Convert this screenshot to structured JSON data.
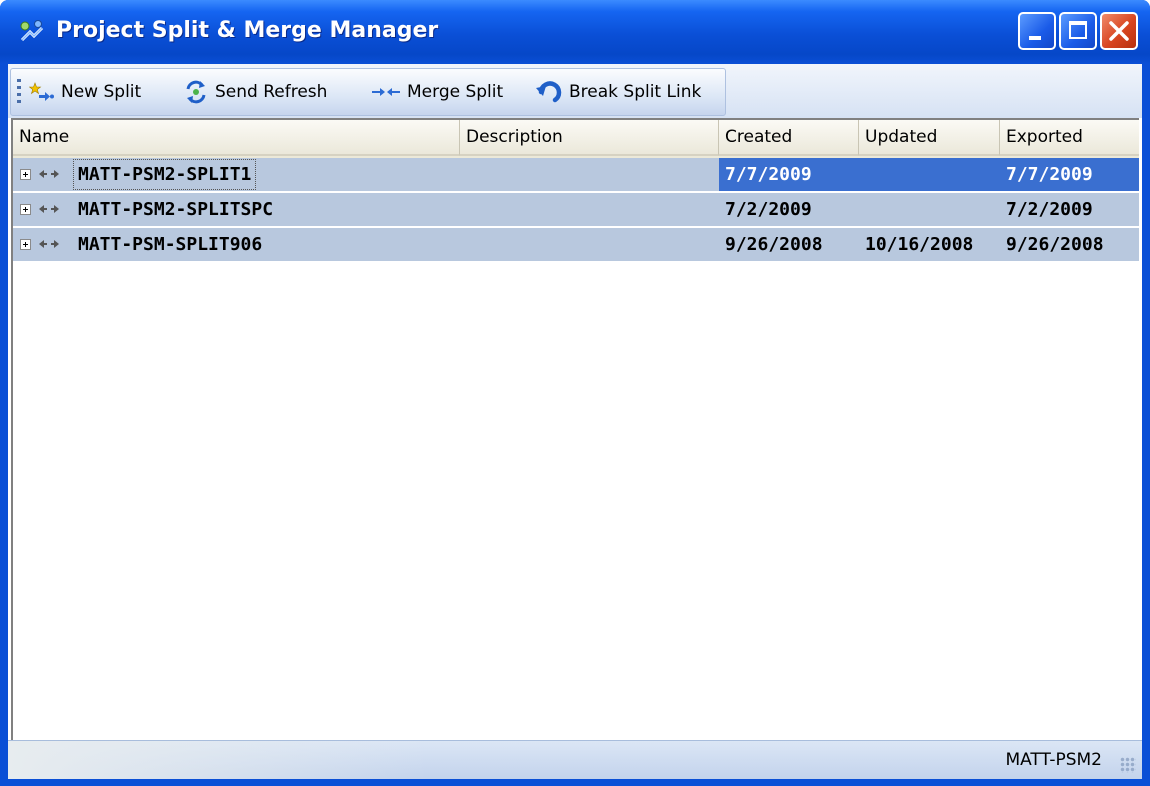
{
  "window": {
    "title": "Project Split & Merge Manager",
    "icon": "split-merge-app-icon",
    "controls": [
      {
        "name": "minimize-button",
        "icon": "minimize-icon"
      },
      {
        "name": "maximize-button",
        "icon": "maximize-icon"
      },
      {
        "name": "close-button",
        "icon": "close-icon"
      }
    ]
  },
  "toolbar": {
    "new_split": "New Split",
    "send_refresh": "Send Refresh",
    "merge_split": "Merge Split",
    "break_split_link": "Break Split Link"
  },
  "grid": {
    "columns": [
      "Name",
      "Description",
      "Created",
      "Updated",
      "Exported"
    ],
    "rows": [
      {
        "name": "MATT-PSM2-SPLIT1",
        "description": "",
        "created": "7/7/2009",
        "updated": "",
        "exported": "7/7/2009",
        "selected": true
      },
      {
        "name": "MATT-PSM2-SPLITSPC",
        "description": "",
        "created": "7/2/2009",
        "updated": "",
        "exported": "7/2/2009",
        "selected": false
      },
      {
        "name": "MATT-PSM-SPLIT906",
        "description": "",
        "created": "9/26/2008",
        "updated": "10/16/2008",
        "exported": "9/26/2008",
        "selected": false
      }
    ]
  },
  "statusbar": {
    "text": "MATT-PSM2"
  },
  "colors": {
    "title_blue": "#0a4fd6",
    "row_bg": "#b8c8de",
    "selection": "#3a6fd0",
    "close_red": "#d8451f"
  }
}
